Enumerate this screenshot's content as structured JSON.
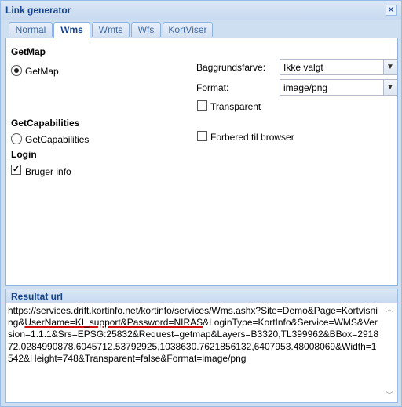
{
  "window": {
    "title": "Link generator",
    "close_icon": "close-icon"
  },
  "tabs": [
    {
      "label": "Normal"
    },
    {
      "label": "Wms"
    },
    {
      "label": "Wmts"
    },
    {
      "label": "Wfs"
    },
    {
      "label": "KortViser"
    }
  ],
  "active_tab": "Wms",
  "getmap": {
    "section_label": "GetMap",
    "radio_label": "GetMap",
    "selected": true
  },
  "background": {
    "label": "Baggrundsfarve:",
    "value": "Ikke valgt"
  },
  "format": {
    "label": "Format:",
    "value": "image/png"
  },
  "transparent": {
    "label": "Transparent",
    "checked": false
  },
  "getcapabilities": {
    "section_label": "GetCapabilities",
    "radio_label": "GetCapabilities",
    "selected": false
  },
  "prepare_browser": {
    "label": "Forbered til browser",
    "checked": false
  },
  "login": {
    "section_label": "Login",
    "user_info_label": "Bruger info",
    "checked": true
  },
  "result": {
    "header": "Resultat url",
    "url_part1": "https://services.drift.kortinfo.net/kortinfo/services/Wms.ashx?Site=Demo&Page=Kortvisning&",
    "url_highlight": "UserName=KI_support&Password=NIRAS",
    "url_part2": "&LoginType=KortInfo&Service=WMS&Version=1.1.1&Srs=EPSG:25832&Request=getmap&Layers=B3320,TL399962&BBox=291872.0284990878,6045712.53792925,1038630.7621856132,6407953.48008069&Width=1542&Height=748&Transparent=false&Format=image/png"
  }
}
